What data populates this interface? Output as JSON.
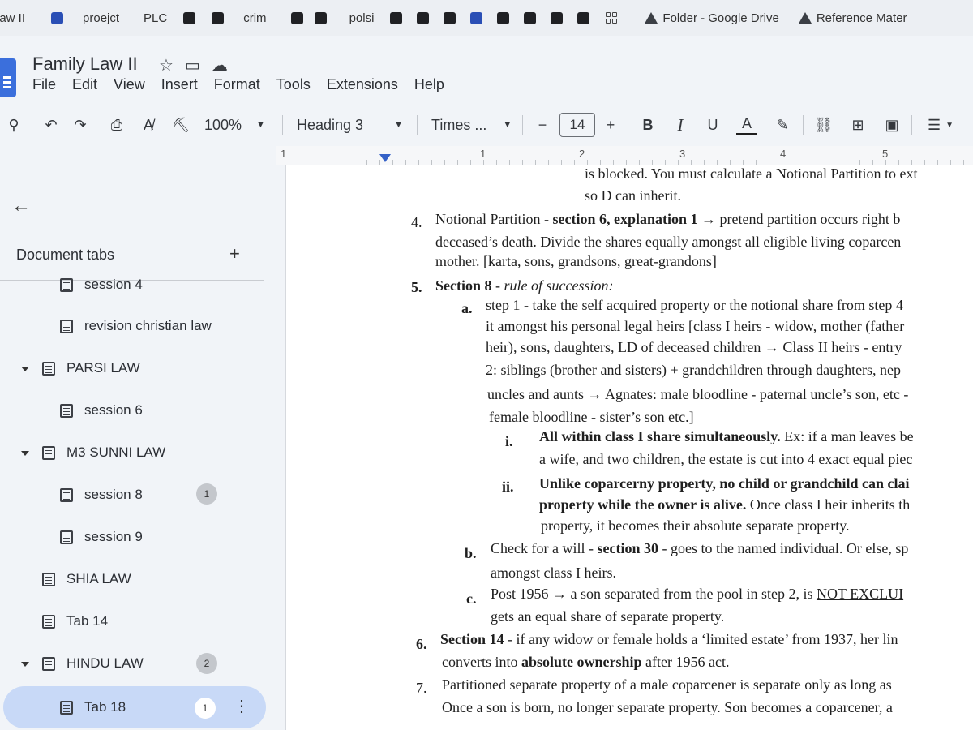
{
  "bookmarks": [
    "law II",
    "proejct",
    "PLC",
    "crim",
    "polsi",
    "Folder - Google Drive",
    "Reference Mater"
  ],
  "app": {
    "title": "Family Law II",
    "menu": [
      "File",
      "Edit",
      "View",
      "Insert",
      "Format",
      "Tools",
      "Extensions",
      "Help"
    ]
  },
  "toolbar": {
    "zoom": "100%",
    "style": "Heading 3",
    "font": "Times ...",
    "minus": "−",
    "font_size": "14",
    "plus": "+",
    "bold": "B",
    "italic": "I",
    "underline": "U",
    "text_color": "A"
  },
  "ruler": {
    "marks": [
      "1",
      "1",
      "2",
      "3",
      "4",
      "5"
    ]
  },
  "sidebar": {
    "header": "Document tabs",
    "add": "+",
    "items": [
      {
        "label": "session 4",
        "level": 2
      },
      {
        "label": "revision christian law",
        "level": 2
      },
      {
        "label": "PARSI LAW",
        "level": 1,
        "expanded": true
      },
      {
        "label": "session 6",
        "level": 2
      },
      {
        "label": "M3 SUNNI LAW",
        "level": 1,
        "expanded": true
      },
      {
        "label": "session 8",
        "level": 2,
        "badge": "1"
      },
      {
        "label": "session 9",
        "level": 2
      },
      {
        "label": "SHIA LAW",
        "level": 1
      },
      {
        "label": "Tab 14",
        "level": 1
      },
      {
        "label": "HINDU LAW",
        "level": 1,
        "expanded": true,
        "badge": "2"
      },
      {
        "label": "Tab 18",
        "level": 2,
        "badge": "1",
        "selected": true
      }
    ]
  },
  "document": {
    "l1": "is blocked. You must calculate a Notional Partition to ext",
    "l2": "so D can inherit.",
    "n4": "4.",
    "l3a": "Notional Partition - ",
    "l3b": "section 6, explanation 1",
    "l3c": " → pretend partition occurs right b",
    "l4": "deceased’s death. Divide the shares equally amongst all eligible living coparcen",
    "l5": "mother. [karta, sons, grandsons, great-grandons]",
    "n5": "5.",
    "l6a": "Section 8",
    "l6b": " - ",
    "l6c": "rule of succession:",
    "na": "a.",
    "l7": "step 1 - take the self acquired property or the notional share from step 4",
    "l8": "it amongst his personal legal heirs [class I heirs - widow, mother (father",
    "l9": "heir), sons, daughters, LD of deceased children → Class II heirs - entry",
    "l10": "2: siblings (brother and sisters) + grandchildren through daughters, nep",
    "l11": "uncles and aunts → Agnates: male bloodline - paternal uncle’s son, etc -",
    "l12": "female bloodline - sister’s son etc.]",
    "ni": "i.",
    "l13a": "All within class I share simultaneously.",
    "l13b": " Ex: if a man leaves be",
    "l14": "a wife, and two children, the estate is cut into 4 exact equal piec",
    "nii": "ii.",
    "l15": "Unlike coparcerny property, no child or grandchild can clai",
    "l16a": "property while the owner is alive.",
    "l16b": " Once class I heir inherits th",
    "l17": "property, it becomes their absolute separate property.",
    "nb": "b.",
    "l18a": "Check for a will - ",
    "l18b": "section 30",
    "l18c": " - goes to the named individual. Or else, sp",
    "l19": "amongst class I heirs.",
    "nc": "c.",
    "l20a": "Post 1956 → a son separated from the pool in step 2, is ",
    "l20b": "NOT EXCLUI",
    "l21": "gets an equal share of separate property.",
    "n6": "6.",
    "l22a": "Section 14",
    "l22b": " - if any widow or female holds a ‘limited estate’ from 1937, her lin",
    "l23a": "converts into ",
    "l23b": "absolute ownership",
    "l23c": " after 1956 act.",
    "n7": "7.",
    "l24": "Partitioned separate property of a male coparcener is separate only as long as",
    "l25": "Once a son is born, no longer separate property. Son becomes a coparcener, a"
  }
}
